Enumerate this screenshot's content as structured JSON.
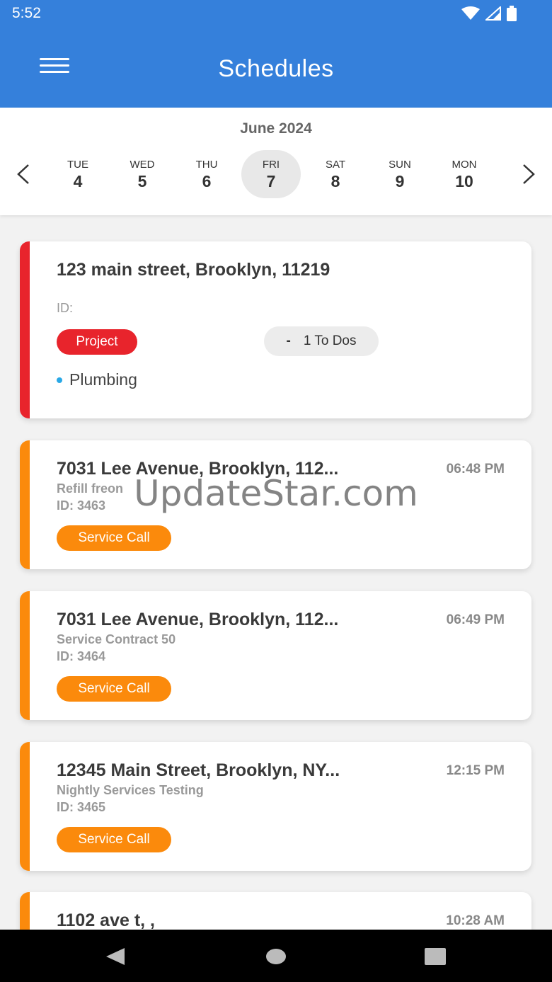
{
  "status": {
    "time": "5:52"
  },
  "header": {
    "title": "Schedules"
  },
  "calendar": {
    "month": "June 2024",
    "days": [
      {
        "name": "TUE",
        "num": "4"
      },
      {
        "name": "WED",
        "num": "5"
      },
      {
        "name": "THU",
        "num": "6"
      },
      {
        "name": "FRI",
        "num": "7"
      },
      {
        "name": "SAT",
        "num": "8"
      },
      {
        "name": "SUN",
        "num": "9"
      },
      {
        "name": "MON",
        "num": "10"
      }
    ],
    "selected_index": 3
  },
  "cards": [
    {
      "address": "123 main street, Brooklyn,  11219",
      "id": "ID:",
      "badge": "Project",
      "todo_sign": "-",
      "todo_label": "1 To Dos",
      "category": "Plumbing",
      "stripe": "#e8242c"
    },
    {
      "address": "7031 Lee Avenue, Brooklyn,  112...",
      "time": "06:48 PM",
      "subtitle": "Refill freon",
      "id": "ID: 3463",
      "badge": "Service Call",
      "stripe": "#fb8a0c"
    },
    {
      "address": "7031 Lee Avenue, Brooklyn,  112...",
      "time": "06:49 PM",
      "subtitle": "Service Contract 50",
      "id": "ID: 3464",
      "badge": "Service Call",
      "stripe": "#fb8a0c"
    },
    {
      "address": "12345 Main Street, Brooklyn, NY...",
      "time": "12:15 PM",
      "subtitle": "Nightly Services Testing",
      "id": "ID: 3465",
      "badge": "Service Call",
      "stripe": "#fb8a0c"
    },
    {
      "address": "1102 ave t, ,",
      "time": "10:28 AM",
      "stripe": "#fb8a0c"
    }
  ],
  "watermark": "UpdateStar.com",
  "colors": {
    "primary": "#3580db",
    "project": "#e8242c",
    "service_call": "#fb8a0c"
  },
  "icons": {
    "menu": "hamburger-icon",
    "prev": "chevron-left-icon",
    "next": "chevron-right-icon"
  }
}
